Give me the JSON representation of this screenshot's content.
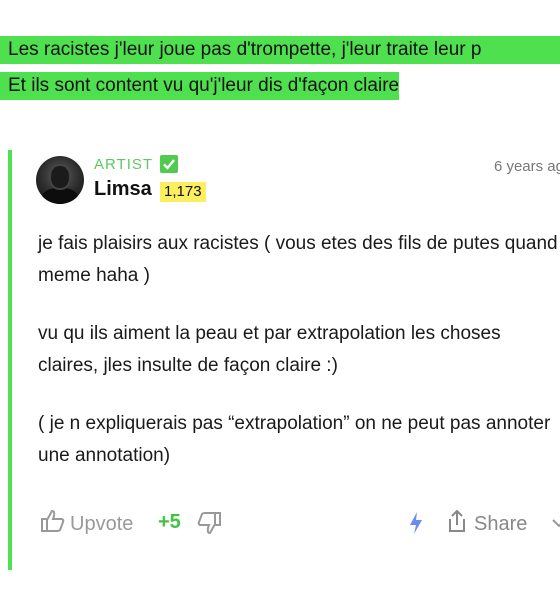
{
  "lyrics": [
    "Les racistes j'leur joue pas d'trompette, j'leur traite leur p",
    "Et ils sont content vu qu'j'leur dis d'façon claire"
  ],
  "annotation": {
    "author_role": "ARTIST",
    "author_name": "Limsa",
    "author_iq": "1,173",
    "timestamp": "6 years ag",
    "paragraphs": [
      "je fais plaisirs aux racistes ( vous etes des fils de putes quand meme haha )",
      "vu qu ils aiment la peau et par extrapolation les choses claires, jles insulte de façon claire :)",
      "( je n expliquerais pas “extrapolation” on ne peut pas annoter une annotation)"
    ]
  },
  "actions": {
    "upvote_label": "Upvote",
    "score": "+5",
    "share_label": "Share"
  },
  "icons": {
    "verified": "check-badge-icon",
    "upvote": "thumbs-up-icon",
    "downvote": "thumbs-down-icon",
    "lightning": "lightning-icon",
    "share": "share-icon",
    "more": "chevron-down-icon"
  },
  "colors": {
    "highlight": "#4fe04f",
    "artist_green": "#5ec85e",
    "iq_yellow": "#fcef5f",
    "score_green": "#3fc43f",
    "bolt_blue": "#6b8cf0"
  }
}
